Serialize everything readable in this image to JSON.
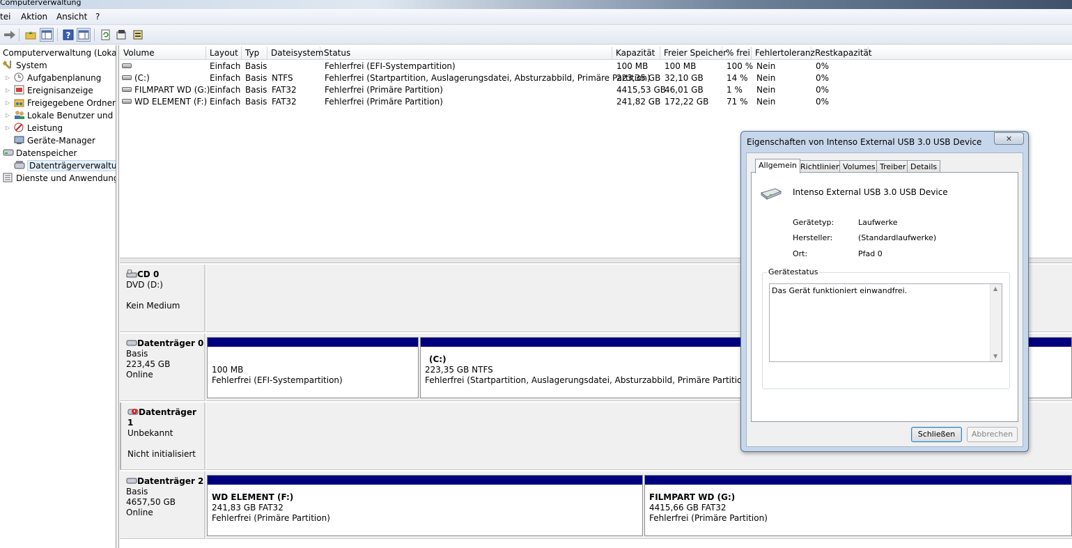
{
  "window": {
    "title": "Computerverwaltung"
  },
  "menu": {
    "items": [
      "tei",
      "Aktion",
      "Ansicht",
      "?"
    ]
  },
  "tree": {
    "root": "Computerverwaltung (Lokal)",
    "system": "System",
    "aufgaben": "Aufgabenplanung",
    "ereignis": "Ereignisanzeige",
    "freigabe": "Freigegebene Ordner",
    "benutzer": "Lokale Benutzer und Gru",
    "leistung": "Leistung",
    "geraete": "Geräte-Manager",
    "datenspeicher": "Datenspeicher",
    "datentraeger": "Datenträgerverwaltung",
    "dienste": "Dienste und Anwendungen"
  },
  "volumes": {
    "headers": {
      "volume": "Volume",
      "layout": "Layout",
      "typ": "Typ",
      "dateisystem": "Dateisystem",
      "status": "Status",
      "kapazitaet": "Kapazität",
      "frei": "Freier Speicher",
      "prozent": "% frei",
      "fehlertoleranz": "Fehlertoleranz",
      "rest": "Restkapazität"
    },
    "rows": [
      {
        "volume": "",
        "layout": "Einfach",
        "typ": "Basis",
        "fs": "",
        "status": "Fehlerfrei (EFI-Systempartition)",
        "kap": "100 MB",
        "frei": "100 MB",
        "proz": "100 %",
        "ft": "Nein",
        "rest": "0%"
      },
      {
        "volume": "(C:)",
        "layout": "Einfach",
        "typ": "Basis",
        "fs": "NTFS",
        "status": "Fehlerfrei (Startpartition, Auslagerungsdatei, Absturzabbild, Primäre Partition)",
        "kap": "223,35 GB",
        "frei": "32,10 GB",
        "proz": "14 %",
        "ft": "Nein",
        "rest": "0%"
      },
      {
        "volume": "FILMPART WD (G:)",
        "layout": "Einfach",
        "typ": "Basis",
        "fs": "FAT32",
        "status": "Fehlerfrei (Primäre Partition)",
        "kap": "4415,53 GB",
        "frei": "46,01 GB",
        "proz": "1 %",
        "ft": "Nein",
        "rest": "0%"
      },
      {
        "volume": "WD ELEMENT (F:)",
        "layout": "Einfach",
        "typ": "Basis",
        "fs": "FAT32",
        "status": "Fehlerfrei (Primäre Partition)",
        "kap": "241,82 GB",
        "frei": "172,22 GB",
        "proz": "71 %",
        "ft": "Nein",
        "rest": "0%"
      }
    ]
  },
  "disks": {
    "cd0": {
      "name": "CD 0",
      "line1": "DVD (D:)",
      "line2": "Kein Medium"
    },
    "disk0": {
      "name": "Datenträger 0",
      "line1": "Basis",
      "line2": "223,45 GB",
      "line3": "Online",
      "p1": {
        "size": "100 MB",
        "status": "Fehlerfrei (EFI-Systempartition)"
      },
      "p2": {
        "name": "(C:)",
        "size": "223,35 GB NTFS",
        "status": "Fehlerfrei (Startpartition, Auslagerungsdatei, Absturzabbild, Primäre Partition)"
      }
    },
    "disk1": {
      "name": "Datenträger 1",
      "line1": "Unbekannt",
      "line2": "Nicht initialisiert"
    },
    "disk2": {
      "name": "Datenträger 2",
      "line1": "Basis",
      "line2": "4657,50 GB",
      "line3": "Online",
      "p1": {
        "name": "WD ELEMENT  (F:)",
        "size": "241,83 GB FAT32",
        "status": "Fehlerfrei (Primäre Partition)"
      },
      "p2": {
        "name": "FILMPART WD  (G:)",
        "size": "4415,66 GB FAT32",
        "status": "Fehlerfrei (Primäre Partition)"
      }
    }
  },
  "dialog": {
    "title": "Eigenschaften von Intenso External USB 3.0 USB Device",
    "tabs": [
      "Allgemein",
      "Richtlinien",
      "Volumes",
      "Treiber",
      "Details"
    ],
    "device_name": "Intenso External USB 3.0 USB Device",
    "fields": [
      {
        "label": "Gerätetyp:",
        "value": "Laufwerke"
      },
      {
        "label": "Hersteller:",
        "value": "(Standardlaufwerke)"
      },
      {
        "label": "Ort:",
        "value": "Pfad 0"
      }
    ],
    "status_group": "Gerätestatus",
    "status_text": "Das Gerät funktioniert einwandfrei.",
    "ok_label": "Schließen",
    "cancel_label": "Abbrechen"
  },
  "colors": {
    "partition_bar": "#00007f",
    "dialog_frame": "#c7d7eb"
  }
}
